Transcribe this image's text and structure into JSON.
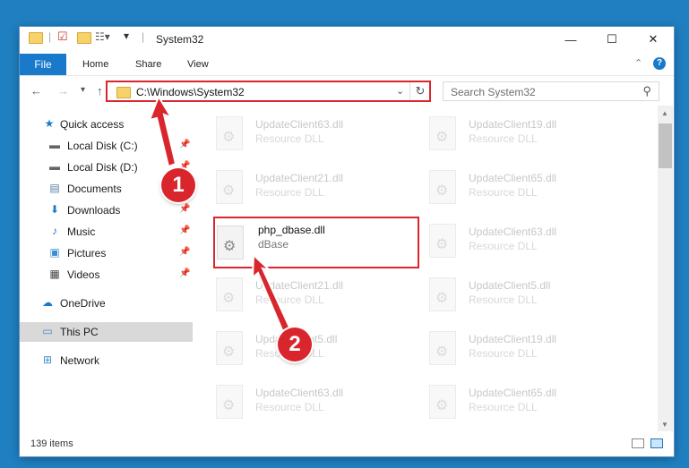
{
  "window": {
    "title": "System32",
    "controls": {
      "minimize": "—",
      "maximize": "☐",
      "close": "✕"
    }
  },
  "ribbon": {
    "tabs": [
      "File",
      "Home",
      "Share",
      "View"
    ],
    "help": "?"
  },
  "address": {
    "path": "C:\\Windows\\System32",
    "search_placeholder": "Search System32"
  },
  "nav": {
    "items": [
      {
        "label": "Quick access",
        "icon": "star-icon"
      },
      {
        "label": "Local Disk (C:)",
        "icon": "drive-icon",
        "pinned": true
      },
      {
        "label": "Local Disk (D:)",
        "icon": "drive-icon",
        "pinned": true
      },
      {
        "label": "Documents",
        "icon": "documents-icon",
        "pinned": true
      },
      {
        "label": "Downloads",
        "icon": "download-icon",
        "pinned": true
      },
      {
        "label": "Music",
        "icon": "music-icon",
        "pinned": true
      },
      {
        "label": "Pictures",
        "icon": "pictures-icon",
        "pinned": true
      },
      {
        "label": "Videos",
        "icon": "videos-icon",
        "pinned": true
      },
      {
        "label": "OneDrive",
        "icon": "cloud-icon"
      },
      {
        "label": "This PC",
        "icon": "computer-icon",
        "selected": true
      },
      {
        "label": "Network",
        "icon": "network-icon"
      }
    ]
  },
  "files": [
    {
      "name": "UpdateClient63.dll",
      "desc": "Resource DLL"
    },
    {
      "name": "UpdateClient19.dll",
      "desc": "Resource DLL"
    },
    {
      "name": "UpdateClient21.dll",
      "desc": "Resource DLL"
    },
    {
      "name": "UpdateClient65.dll",
      "desc": "Resource DLL"
    },
    {
      "name": "php_dbase.dll",
      "desc": "dBase",
      "highlighted": true
    },
    {
      "name": "UpdateClient63.dll",
      "desc": "Resource DLL"
    },
    {
      "name": "UpdateClient21.dll",
      "desc": "Resource DLL"
    },
    {
      "name": "UpdateClient5.dll",
      "desc": "Resource DLL"
    },
    {
      "name": "UpdateClient5.dll",
      "desc": "Resource DLL"
    },
    {
      "name": "UpdateClient19.dll",
      "desc": "Resource DLL"
    },
    {
      "name": "UpdateClient63.dll",
      "desc": "Resource DLL"
    },
    {
      "name": "UpdateClient65.dll",
      "desc": "Resource DLL"
    }
  ],
  "status": {
    "item_count": "139 items"
  },
  "annotations": {
    "step1": "1",
    "step2": "2",
    "color": "#d9262d"
  }
}
